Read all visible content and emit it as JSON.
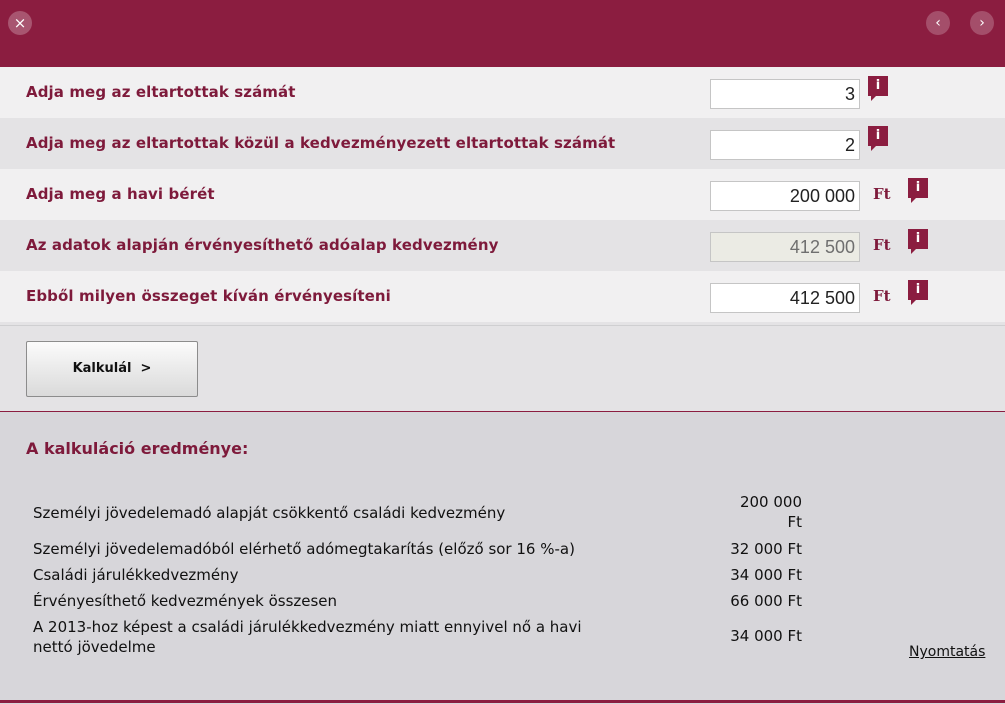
{
  "header": {
    "close_icon": "×",
    "prev_icon": "‹",
    "next_icon": "›"
  },
  "form": {
    "info_icon": "i",
    "rows": [
      {
        "label": "Adja meg az eltartottak számát",
        "value": "3",
        "unit": ""
      },
      {
        "label": "Adja meg az eltartottak közül a kedvezményezett eltartottak számát",
        "value": "2",
        "unit": ""
      },
      {
        "label": "Adja meg a havi bérét",
        "value": "200 000",
        "unit": "Ft"
      },
      {
        "label": "Az adatok alapján érvényesíthető adóalap kedvezmény",
        "value": "412 500",
        "unit": "Ft"
      },
      {
        "label": "Ebből milyen összeget kíván érvényesíteni",
        "value": "412 500",
        "unit": "Ft"
      }
    ]
  },
  "actions": {
    "calculate_label": "Kalkulál  >"
  },
  "results": {
    "title": "A kalkuláció eredménye:",
    "rows": [
      {
        "label": "Személyi jövedelemadó alapját csökkentő családi kedvezmény",
        "value_line1": "200 000",
        "value_line2": "Ft"
      },
      {
        "label": "Személyi jövedelemadóból elérhető adómegtakarítás (előző sor 16 %-a)",
        "value": "32 000 Ft"
      },
      {
        "label": "Családi járulékkedvezmény",
        "value": "34 000 Ft"
      },
      {
        "label": "Érvényesíthető kedvezmények összesen",
        "value": "66 000 Ft"
      },
      {
        "label_line1": "A 2013-hoz képest a családi járulékkedvezmény miatt ennyivel nő a havi",
        "label_line2": "nettó jövedelme",
        "value": "34 000 Ft"
      }
    ],
    "print_label": "Nyomtatás"
  },
  "colors": {
    "brand": "#8b1d40",
    "label_text": "#7e1a3b"
  }
}
